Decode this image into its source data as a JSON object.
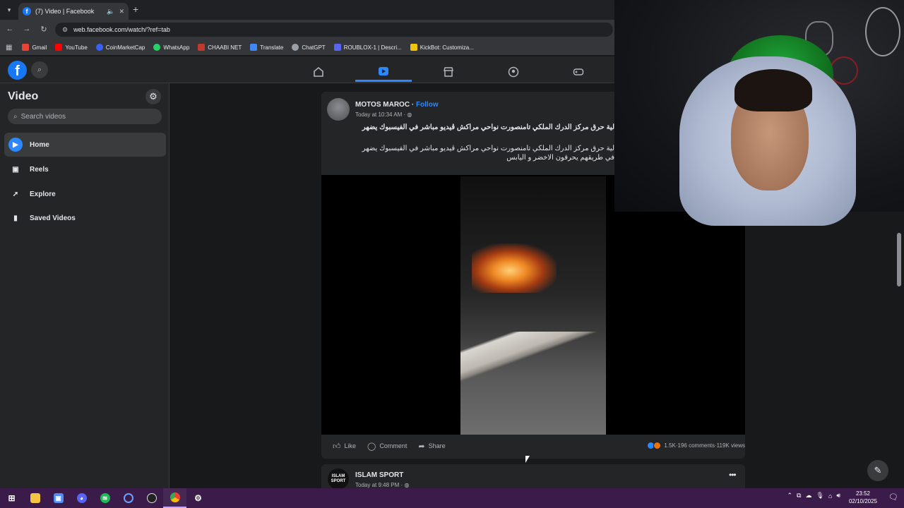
{
  "browser": {
    "tab_title": "(7) Video | Facebook",
    "url": "web.facebook.com/watch/?ref=tab",
    "bookmarks": [
      "Gmail",
      "YouTube",
      "CoinMarketCap",
      "WhatsApp",
      "CHAABI NET",
      "Translate",
      "ChatGPT",
      "ROUBLOX-1 | Descri...",
      "KickBot: Customiza..."
    ]
  },
  "sidebar": {
    "title": "Video",
    "search_placeholder": "Search videos",
    "items": [
      {
        "label": "Home"
      },
      {
        "label": "Reels"
      },
      {
        "label": "Explore"
      },
      {
        "label": "Saved Videos"
      }
    ]
  },
  "post1": {
    "author": "MOTOS MAROC",
    "follow": "Follow",
    "separator": " · ",
    "time": "Today at 10:34 AM ·",
    "text_line1": "لية حرق مركز الدرك الملكي تامنصورت نواحي مراكش ڤيديو مباشر في الفيسبوك يضهر",
    "text_line2": "لية حرق مركز الدرك الملكي تامنصورت نواحي مراكش ڤيديو مباشر في الفيسبوك يضهر",
    "text_line3": "في طريقهم يحرقون الاخضر و اليابس",
    "like": "Like",
    "comment": "Comment",
    "share": "Share",
    "reactions": "1.5K",
    "comments_count": "196 comments",
    "views": "119K views",
    "dot": " · "
  },
  "post2": {
    "author": "ISLAM SPORT",
    "time": "Today at 9:48 PM ·",
    "avatar_text": "ISLAM SPORT"
  },
  "taskbar": {
    "time": "23:52",
    "date": "02/10/2025"
  },
  "colors": {
    "accent": "#2d88ff",
    "fb_blue": "#1877f2",
    "taskbar": "#3a1b4a"
  }
}
